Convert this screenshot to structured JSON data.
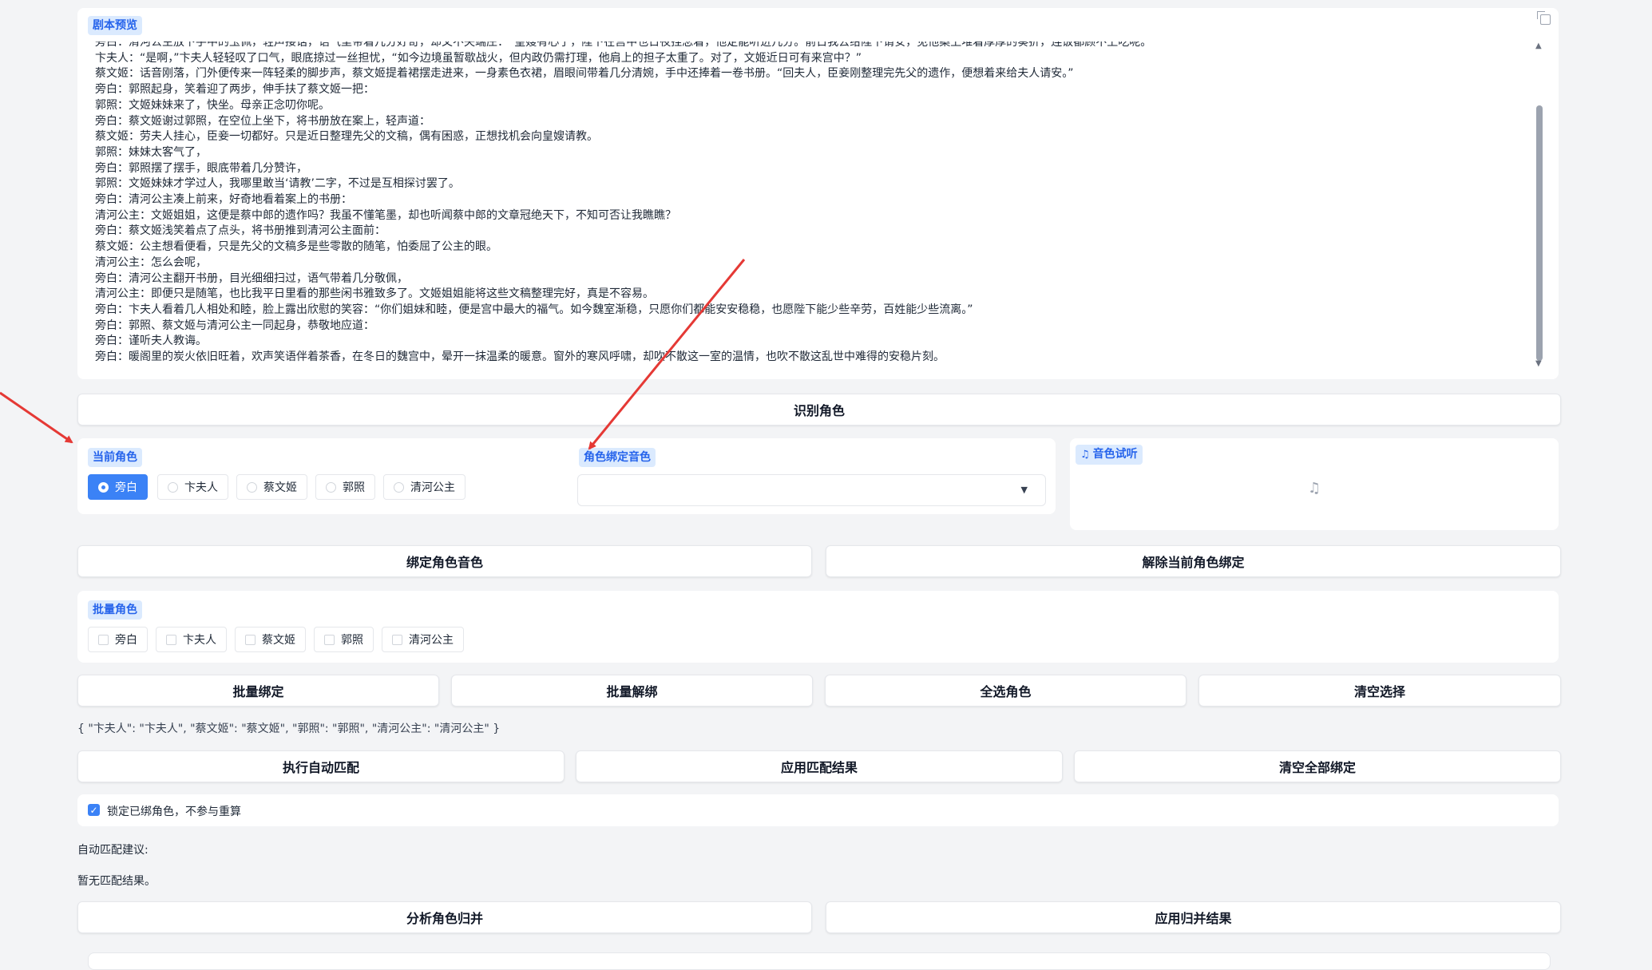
{
  "script_preview": {
    "label": "剧本预览",
    "lines": [
      "旁白：清河公主放下手中的玉佩，轻声接话，语气里带着几分好奇，却又不失端庄：“皇嫂有心了，陛下在宫中也日夜挂念着，他定能听进几分。前日我去给陛下请安，见他案上堆着厚厚的奏折，连饭都顾不上吃呢。",
      "卞夫人：“是啊，”卞夫人轻轻叹了口气，眼底掠过一丝担忧，“如今边境虽暂歇战火，但内政仍需打理，他肩上的担子太重了。对了，文姬近日可有来宫中？”",
      "蔡文姬：话音刚落，门外便传来一阵轻柔的脚步声，蔡文姬提着裙摆走进来，一身素色衣裙，眉眼间带着几分清婉，手中还捧着一卷书册。“回夫人，臣妾刚整理完先父的遗作，便想着来给夫人请安。”",
      "旁白：郭照起身，笑着迎了两步，伸手扶了蔡文姬一把：",
      "郭照：文姬妹妹来了，快坐。母亲正念叨你呢。",
      "旁白：蔡文姬谢过郭照，在空位上坐下，将书册放在案上，轻声道：",
      "蔡文姬：劳夫人挂心，臣妾一切都好。只是近日整理先父的文稿，偶有困惑，正想找机会向皇嫂请教。",
      "郭照：妹妹太客气了，",
      "旁白：郭照摆了摆手，眼底带着几分赞许，",
      "郭照：文姬妹妹才学过人，我哪里敢当‘请教’二字，不过是互相探讨罢了。",
      "旁白：清河公主凑上前来，好奇地看着案上的书册：",
      "清河公主：文姬姐姐，这便是蔡中郎的遗作吗？我虽不懂笔墨，却也听闻蔡中郎的文章冠绝天下，不知可否让我瞧瞧？",
      "旁白：蔡文姬浅笑着点了点头，将书册推到清河公主面前：",
      "蔡文姬：公主想看便看，只是先父的文稿多是些零散的随笔，怕委屈了公主的眼。",
      "清河公主：怎么会呢，",
      "旁白：清河公主翻开书册，目光细细扫过，语气带着几分敬佩，",
      "清河公主：即便只是随笔，也比我平日里看的那些闲书雅致多了。文姬姐姐能将这些文稿整理完好，真是不容易。",
      "旁白：卞夫人看着几人相处和睦，脸上露出欣慰的笑容：“你们姐妹和睦，便是宫中最大的福气。如今魏室渐稳，只愿你们都能安安稳稳，也愿陛下能少些辛劳，百姓能少些流离。”",
      "旁白：郭照、蔡文姬与清河公主一同起身，恭敬地应道：",
      "旁白：谨听夫人教诲。",
      "旁白：暖阁里的炭火依旧旺着，欢声笑语伴着茶香，在冬日的魏宫中，晕开一抹温柔的暖意。窗外的寒风呼啸，却吹不散这一室的温情，也吹不散这乱世中难得的安稳片刻。"
    ]
  },
  "identify_button": "识别角色",
  "current_role": {
    "label": "当前角色",
    "options": [
      "旁白",
      "卞夫人",
      "蔡文姬",
      "郭照",
      "清河公主"
    ],
    "selected": "旁白"
  },
  "voice_bind": {
    "label": "角色绑定音色",
    "value": ""
  },
  "voice_preview": {
    "label": "音色试听"
  },
  "bind_button": "绑定角色音色",
  "unbind_button": "解除当前角色绑定",
  "batch_roles": {
    "label": "批量角色",
    "options": [
      "旁白",
      "卞夫人",
      "蔡文姬",
      "郭照",
      "清河公主"
    ]
  },
  "batch_buttons": [
    "批量绑定",
    "批量解绑",
    "全选角色",
    "清空选择"
  ],
  "mapping_json": "{ \"卞夫人\": \"卞夫人\", \"蔡文姬\": \"蔡文姬\", \"郭照\": \"郭照\", \"清河公主\": \"清河公主\" }",
  "match_buttons": [
    "执行自动匹配",
    "应用匹配结果",
    "清空全部绑定"
  ],
  "lock_checkbox": {
    "label": "锁定已绑角色，不参与重算",
    "checked": true
  },
  "auto_match_label": "自动匹配建议:",
  "no_match_text": "暂无匹配结果。",
  "merge_buttons": [
    "分析角色归并",
    "应用归并结果"
  ],
  "colors": {
    "accent": "#3b82f6",
    "badge_bg": "#dbeafe",
    "badge_text": "#2563eb",
    "annotation_arrow": "#e53935"
  }
}
